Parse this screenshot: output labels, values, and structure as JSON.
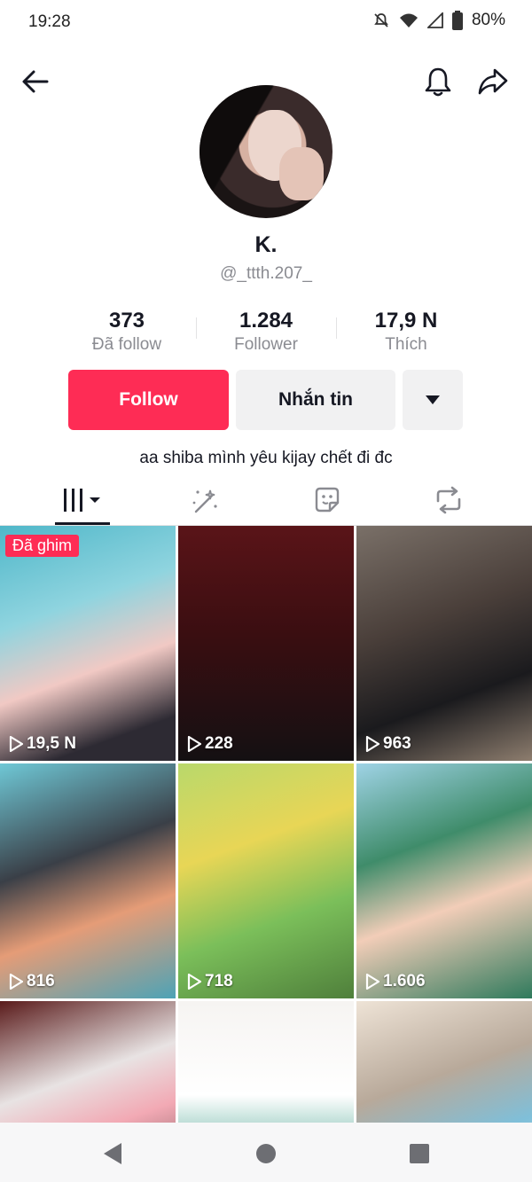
{
  "status_bar": {
    "time": "19:28",
    "battery": "80%"
  },
  "profile": {
    "display_name": "K.",
    "username": "@_ttth.207_",
    "bio": "aa shiba mình yêu kijay chết đi đc",
    "stats": [
      {
        "value": "373",
        "label": "Đã follow"
      },
      {
        "value": "1.284",
        "label": "Follower"
      },
      {
        "value": "17,9 N",
        "label": "Thích"
      }
    ]
  },
  "actions": {
    "follow": "Follow",
    "message": "Nhắn tin"
  },
  "tabs": [
    "videos-grid",
    "favorites",
    "stickers",
    "reposts"
  ],
  "videos": [
    {
      "views": "19,5 N",
      "pinned": "Đã ghim"
    },
    {
      "views": "228"
    },
    {
      "views": "963"
    },
    {
      "views": "816"
    },
    {
      "views": "718"
    },
    {
      "views": "1.606"
    },
    {
      "views": ""
    },
    {
      "views": ""
    },
    {
      "views": ""
    }
  ],
  "colors": {
    "accent": "#fe2c55",
    "secondary_button": "#f1f1f2",
    "muted_text": "#8a8b91"
  }
}
